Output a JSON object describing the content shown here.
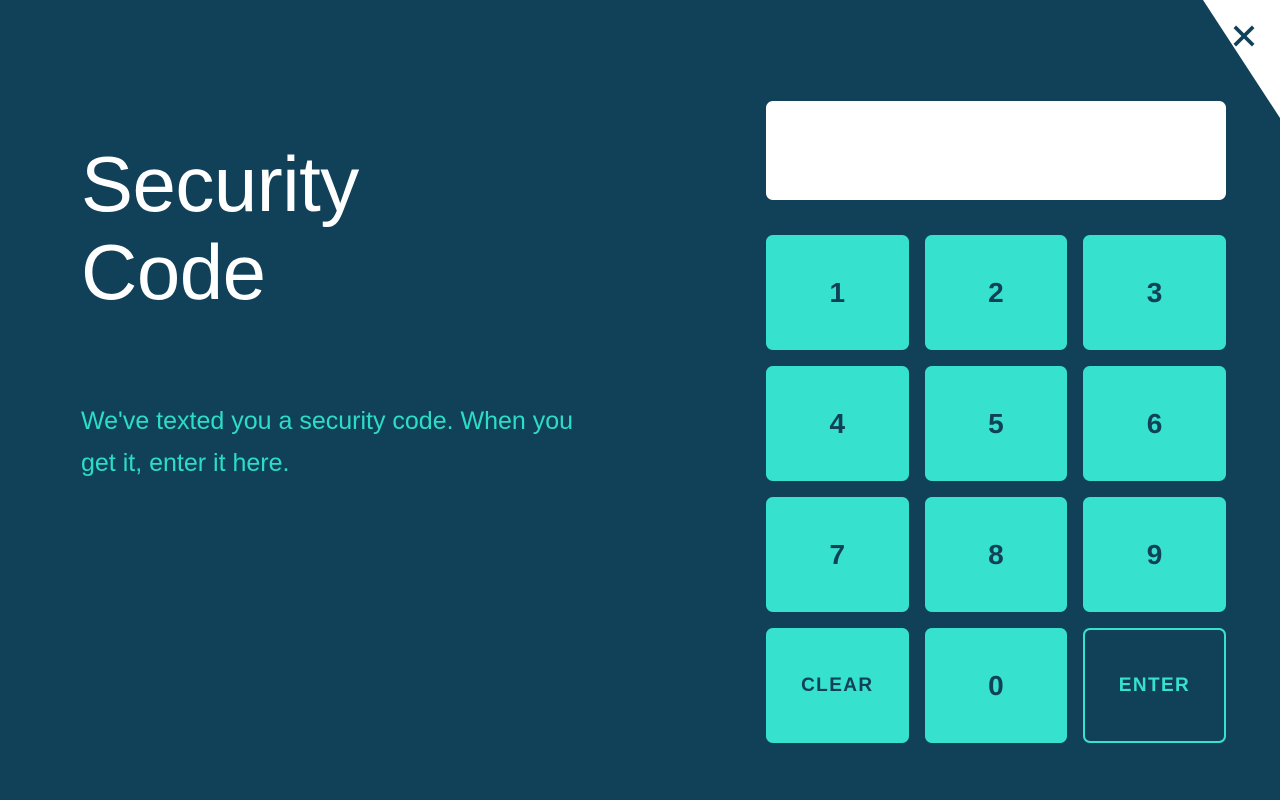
{
  "theme": {
    "background": "#114159",
    "accent": "#36e1cd",
    "subtitle_color": "#2ddcc6",
    "title_color": "#ffffff",
    "field_background": "#ffffff",
    "key_text_color": "#114159"
  },
  "window": {
    "close_icon": "close-icon",
    "close_label": "Close"
  },
  "content": {
    "title": "Security Code",
    "subtitle": "We've texted you a security code. When you get it, enter it here."
  },
  "code_entry": {
    "value": "",
    "placeholder": ""
  },
  "keypad": {
    "keys": [
      {
        "label": "1",
        "name": "keypad-key-1",
        "type": "digit"
      },
      {
        "label": "2",
        "name": "keypad-key-2",
        "type": "digit"
      },
      {
        "label": "3",
        "name": "keypad-key-3",
        "type": "digit"
      },
      {
        "label": "4",
        "name": "keypad-key-4",
        "type": "digit"
      },
      {
        "label": "5",
        "name": "keypad-key-5",
        "type": "digit"
      },
      {
        "label": "6",
        "name": "keypad-key-6",
        "type": "digit"
      },
      {
        "label": "7",
        "name": "keypad-key-7",
        "type": "digit"
      },
      {
        "label": "8",
        "name": "keypad-key-8",
        "type": "digit"
      },
      {
        "label": "9",
        "name": "keypad-key-9",
        "type": "digit"
      },
      {
        "label": "CLEAR",
        "name": "keypad-clear-button",
        "type": "word"
      },
      {
        "label": "0",
        "name": "keypad-key-0",
        "type": "digit"
      },
      {
        "label": "ENTER",
        "name": "keypad-enter-button",
        "type": "ghost"
      }
    ]
  }
}
